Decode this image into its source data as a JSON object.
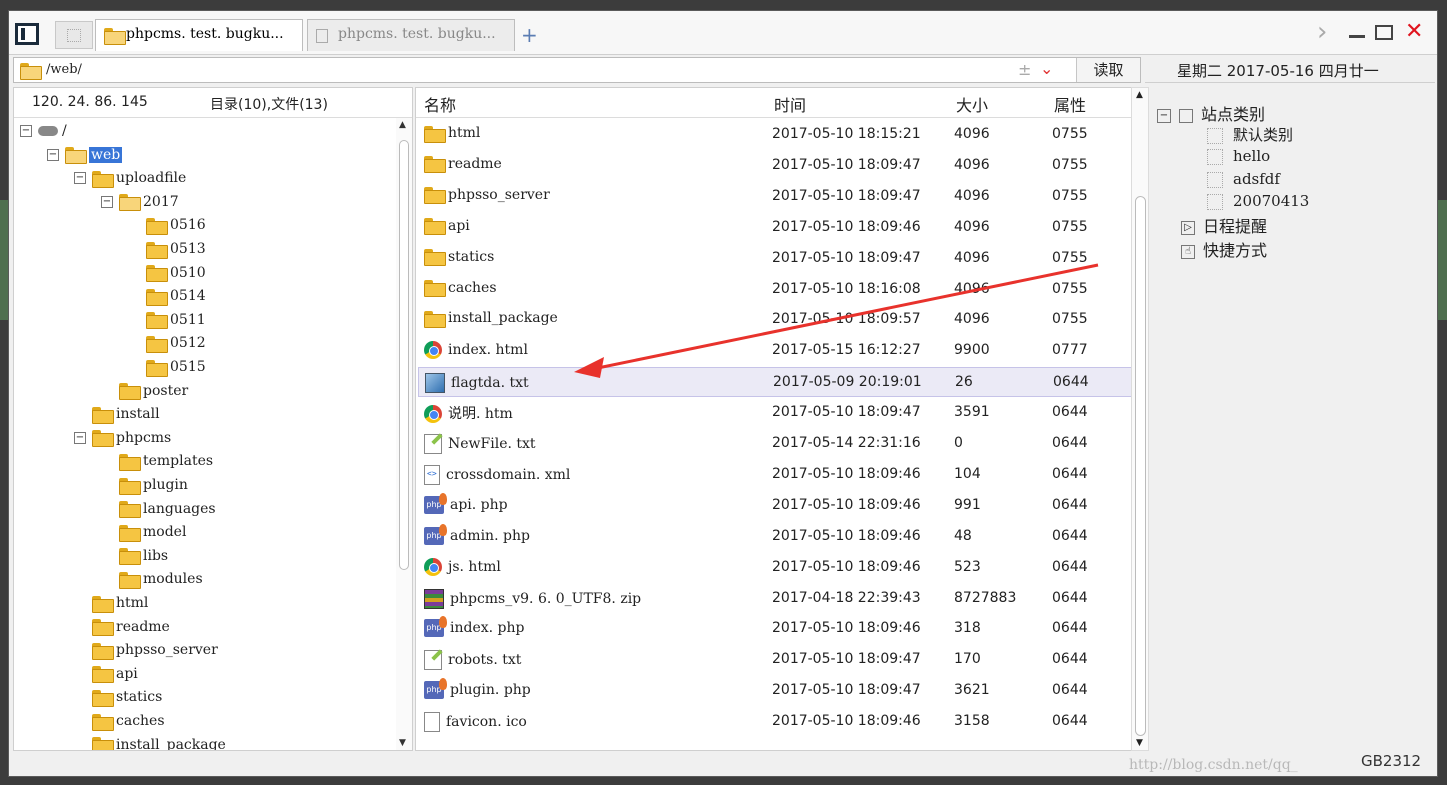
{
  "tabs": {
    "active": "phpcms. test. bugku...",
    "inactive": "phpcms. test. bugku..."
  },
  "address": {
    "path": "/web/",
    "read_button": "读取",
    "date": "星期二 2017-05-16 四月廿一"
  },
  "left_panel": {
    "ip": "120. 24. 86. 145",
    "count": "目录(10),文件(13)",
    "tree": [
      {
        "label": "/",
        "indent": 0,
        "toggle": "⊟",
        "icon": "drive"
      },
      {
        "label": "web",
        "indent": 1,
        "toggle": "⊟",
        "icon": "folder-open",
        "selected": true
      },
      {
        "label": "uploadfile",
        "indent": 2,
        "toggle": "⊟",
        "icon": "folder"
      },
      {
        "label": "2017",
        "indent": 3,
        "toggle": "⊟",
        "icon": "folder-open"
      },
      {
        "label": "0516",
        "indent": 4,
        "icon": "folder"
      },
      {
        "label": "0513",
        "indent": 4,
        "icon": "folder"
      },
      {
        "label": "0510",
        "indent": 4,
        "icon": "folder"
      },
      {
        "label": "0514",
        "indent": 4,
        "icon": "folder"
      },
      {
        "label": "0511",
        "indent": 4,
        "icon": "folder"
      },
      {
        "label": "0512",
        "indent": 4,
        "icon": "folder"
      },
      {
        "label": "0515",
        "indent": 4,
        "icon": "folder"
      },
      {
        "label": "poster",
        "indent": 3,
        "icon": "folder"
      },
      {
        "label": "install",
        "indent": 2,
        "icon": "folder"
      },
      {
        "label": "phpcms",
        "indent": 2,
        "toggle": "⊟",
        "icon": "folder"
      },
      {
        "label": "templates",
        "indent": 3,
        "icon": "folder"
      },
      {
        "label": "plugin",
        "indent": 3,
        "icon": "folder"
      },
      {
        "label": "languages",
        "indent": 3,
        "icon": "folder"
      },
      {
        "label": "model",
        "indent": 3,
        "icon": "folder"
      },
      {
        "label": "libs",
        "indent": 3,
        "icon": "folder"
      },
      {
        "label": "modules",
        "indent": 3,
        "icon": "folder"
      },
      {
        "label": "html",
        "indent": 2,
        "icon": "folder"
      },
      {
        "label": "readme",
        "indent": 2,
        "icon": "folder"
      },
      {
        "label": "phpsso_server",
        "indent": 2,
        "icon": "folder"
      },
      {
        "label": "api",
        "indent": 2,
        "icon": "folder"
      },
      {
        "label": "statics",
        "indent": 2,
        "icon": "folder"
      },
      {
        "label": "caches",
        "indent": 2,
        "icon": "folder"
      },
      {
        "label": "install_package",
        "indent": 2,
        "icon": "folder"
      }
    ]
  },
  "file_list": {
    "headers": {
      "name": "名称",
      "time": "时间",
      "size": "大小",
      "attr": "属性"
    },
    "rows": [
      {
        "name": "html",
        "time": "2017-05-10 18:15:21",
        "size": "4096",
        "attr": "0755",
        "icon": "folder"
      },
      {
        "name": "readme",
        "time": "2017-05-10 18:09:47",
        "size": "4096",
        "attr": "0755",
        "icon": "folder"
      },
      {
        "name": "phpsso_server",
        "time": "2017-05-10 18:09:47",
        "size": "4096",
        "attr": "0755",
        "icon": "folder"
      },
      {
        "name": "api",
        "time": "2017-05-10 18:09:46",
        "size": "4096",
        "attr": "0755",
        "icon": "folder"
      },
      {
        "name": "statics",
        "time": "2017-05-10 18:09:47",
        "size": "4096",
        "attr": "0755",
        "icon": "folder"
      },
      {
        "name": "caches",
        "time": "2017-05-10 18:16:08",
        "size": "4096",
        "attr": "0755",
        "icon": "folder"
      },
      {
        "name": "install_package",
        "time": "2017-05-10 18:09:57",
        "size": "4096",
        "attr": "0755",
        "icon": "folder"
      },
      {
        "name": "index. html",
        "time": "2017-05-15 16:12:27",
        "size": "9900",
        "attr": "0777",
        "icon": "chrome"
      },
      {
        "name": "flagtda. txt",
        "time": "2017-05-09 20:19:01",
        "size": "26",
        "attr": "0644",
        "icon": "image",
        "selected": true
      },
      {
        "name": "说明. htm",
        "time": "2017-05-10 18:09:47",
        "size": "3591",
        "attr": "0644",
        "icon": "chrome"
      },
      {
        "name": "NewFile. txt",
        "time": "2017-05-14 22:31:16",
        "size": "0",
        "attr": "0644",
        "icon": "text"
      },
      {
        "name": "crossdomain. xml",
        "time": "2017-05-10 18:09:46",
        "size": "104",
        "attr": "0644",
        "icon": "xml"
      },
      {
        "name": "api. php",
        "time": "2017-05-10 18:09:46",
        "size": "991",
        "attr": "0644",
        "icon": "php"
      },
      {
        "name": "admin. php",
        "time": "2017-05-10 18:09:46",
        "size": "48",
        "attr": "0644",
        "icon": "php"
      },
      {
        "name": "js. html",
        "time": "2017-05-10 18:09:46",
        "size": "523",
        "attr": "0644",
        "icon": "chrome"
      },
      {
        "name": "phpcms_v9. 6. 0_UTF8. zip",
        "time": "2017-04-18 22:39:43",
        "size": "8727883",
        "attr": "0644",
        "icon": "zip"
      },
      {
        "name": "index. php",
        "time": "2017-05-10 18:09:46",
        "size": "318",
        "attr": "0644",
        "icon": "php"
      },
      {
        "name": "robots. txt",
        "time": "2017-05-10 18:09:47",
        "size": "170",
        "attr": "0644",
        "icon": "text"
      },
      {
        "name": "plugin. php",
        "time": "2017-05-10 18:09:47",
        "size": "3621",
        "attr": "0644",
        "icon": "php"
      },
      {
        "name": "favicon. ico",
        "time": "2017-05-10 18:09:46",
        "size": "3158",
        "attr": "0644",
        "icon": "file"
      }
    ]
  },
  "right_panel": {
    "category_root": "站点类别",
    "categories": [
      "默认类别",
      "hello",
      "adsfdf",
      "20070413"
    ],
    "schedule": "日程提醒",
    "shortcut": "快捷方式"
  },
  "status": {
    "watermark": "http://blog.csdn.net/qq_",
    "encoding": "GB2312"
  },
  "colors": {
    "selection": "#3875d7",
    "arrow": "#e8322c",
    "close": "#e0141e"
  }
}
